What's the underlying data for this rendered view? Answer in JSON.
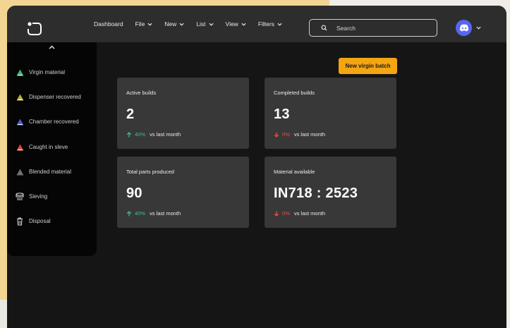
{
  "nav": {
    "dashboard": "Dashboard",
    "file": "File",
    "new": "New",
    "list": "List",
    "view": "View",
    "filters": "Filters"
  },
  "search": {
    "placeholder": "Search"
  },
  "user": {
    "avatar_icon": "discord-icon",
    "avatar_color": "#5865f2"
  },
  "sidebar": {
    "items": [
      {
        "label": "Virgin material",
        "icon": "triangle-green-icon",
        "color": "#3cb878"
      },
      {
        "label": "Dispenser recovered",
        "icon": "triangle-olive-icon",
        "color": "#b8b23a"
      },
      {
        "label": "Chamber recovered",
        "icon": "triangle-blue-icon",
        "color": "#4a5fd6"
      },
      {
        "label": "Caught in sleve",
        "icon": "triangle-red-icon",
        "color": "#d84a3a"
      },
      {
        "label": "Blended material",
        "icon": "triangle-gray-icon",
        "color": "#707070"
      },
      {
        "label": "Sieving",
        "icon": "sieve-icon"
      },
      {
        "label": "Disposal",
        "icon": "trash-icon"
      }
    ]
  },
  "actions": {
    "new_batch": "New virgin batch"
  },
  "cards": [
    {
      "title": "Active builds",
      "value": "2",
      "trend": "up",
      "pct": "40%",
      "vs": "vs last month"
    },
    {
      "title": "Completed builds",
      "value": "13",
      "trend": "down",
      "pct": "0%",
      "vs": "vs last month"
    },
    {
      "title": "Total parts produced",
      "value": "90",
      "trend": "up",
      "pct": "40%",
      "vs": "vs last month"
    },
    {
      "title": "Material available",
      "value": "IN718 : 2523",
      "trend": "down",
      "pct": "0%",
      "vs": "vs last month"
    }
  ],
  "colors": {
    "accent": "#f3a512",
    "up": "#3cc08a",
    "down": "#e8504a",
    "card_bg": "#383838",
    "topbar_bg": "#2d2d2d"
  }
}
